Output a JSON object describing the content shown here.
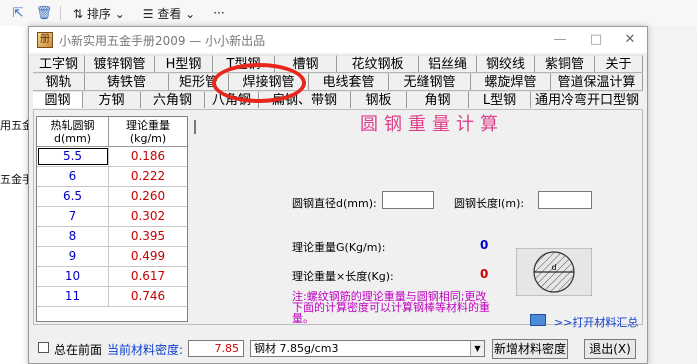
{
  "explorer": {
    "toolbar": {
      "sort_label": "排序",
      "view_label": "查看",
      "more_label": "···"
    },
    "left_items": [
      "用五金",
      "五金手"
    ]
  },
  "window": {
    "title": "小新实用五金手册2009 — 小小新出品",
    "buttons": {
      "minimize": "—",
      "maximize": "□",
      "close": "✕"
    }
  },
  "tabs": {
    "row1": [
      "工字钢",
      "镀锌钢管",
      "H型钢",
      "T型钢",
      "槽钢",
      "花纹钢板",
      "铝丝绳",
      "钢绞线",
      "紫铜管",
      "关于"
    ],
    "row2": [
      "钢轨",
      "铸铁管",
      "矩形管",
      "焊接钢管",
      "电线套管",
      "无缝钢管",
      "螺旋焊管",
      "管道保温计算"
    ],
    "row3": [
      "圆钢",
      "方钢",
      "六角钢",
      "八角钢",
      "扁钢、带钢",
      "钢板",
      "角钢",
      "L型钢",
      "通用冷弯开口型钢"
    ]
  },
  "table": {
    "headers": [
      "热轧圆钢\nd(mm)",
      "理论重量\n(kg/m)"
    ],
    "rows": [
      {
        "d": "5.5",
        "w": "0.186"
      },
      {
        "d": "6",
        "w": "0.222"
      },
      {
        "d": "6.5",
        "w": "0.260"
      },
      {
        "d": "7",
        "w": "0.302"
      },
      {
        "d": "8",
        "w": "0.395"
      },
      {
        "d": "9",
        "w": "0.499"
      },
      {
        "d": "10",
        "w": "0.617"
      },
      {
        "d": "11",
        "w": "0.746"
      }
    ]
  },
  "calc": {
    "title": "圆钢重量计算",
    "diameter_label": "圆钢直径d(mm):",
    "length_label": "圆钢长度l(m):",
    "weight_label": "理论重量G(Kg/m):",
    "weight_value": "0",
    "total_label": "理论重量×长度(Kg):",
    "total_value": "0",
    "note": "注:螺纹钢筋的理论重量与圆钢相同;更改下面的计算密度可以计算钢棒等材料的重量。",
    "diagram_label": "d",
    "open_link": ">>打开材料汇总"
  },
  "footer": {
    "always_on_top_label": "总在前面",
    "density_label": "当前材料密度:",
    "density_value": "7.85",
    "material_select": "钢材 7.85g/cm3",
    "add_density_button": "新增材料密度",
    "exit_button": "退出(X)"
  },
  "colors": {
    "annotation": "#e8261c",
    "title_pink": "#e0408c",
    "value_blue": "#0000c8",
    "value_red": "#c80000"
  }
}
